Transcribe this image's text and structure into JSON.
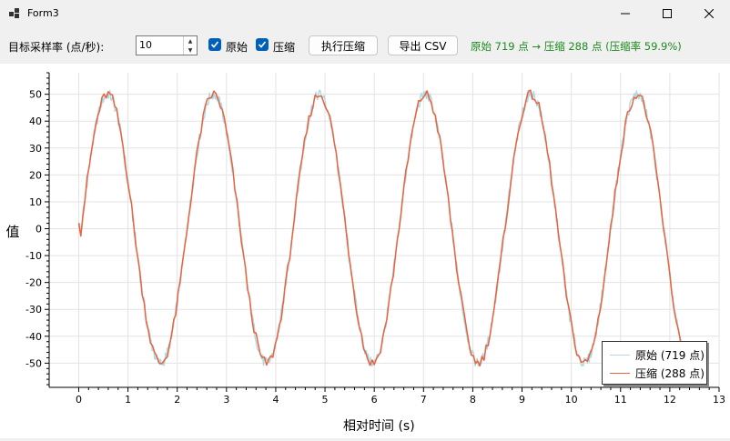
{
  "window": {
    "title": "Form3"
  },
  "toolbar": {
    "rate_label": "目标采样率 (点/秒):",
    "rate_value": "10",
    "original_label": "原始",
    "compressed_label": "压缩",
    "compress_button": "执行压缩",
    "export_button": "导出 CSV",
    "status_text": "原始 719 点 → 压缩 288 点 (压缩率 59.9%)",
    "status_color": "#1c8a1c"
  },
  "chart_data": {
    "type": "line",
    "xlabel": "相对时间 (s)",
    "ylabel": "值",
    "xlim": [
      -0.6,
      13
    ],
    "ylim": [
      -59,
      58
    ],
    "xticks": [
      0,
      1,
      2,
      3,
      4,
      5,
      6,
      7,
      8,
      9,
      10,
      11,
      12,
      13
    ],
    "yticks": [
      50,
      40,
      30,
      20,
      10,
      0,
      -10,
      -20,
      -30,
      -40,
      -50
    ],
    "grid": true,
    "legend_position": "bottom-right",
    "series": [
      {
        "name": "原始 (719 点)",
        "color": "#add8e6",
        "amplitude": 50,
        "period_s": 2.15,
        "phase_s": 0.05,
        "duration_s": 12.3,
        "points": 719
      },
      {
        "name": "压缩 (288 点)",
        "color": "#e8643c",
        "amplitude": 50,
        "period_s": 2.15,
        "phase_s": 0.05,
        "duration_s": 12.3,
        "points": 288
      }
    ]
  }
}
